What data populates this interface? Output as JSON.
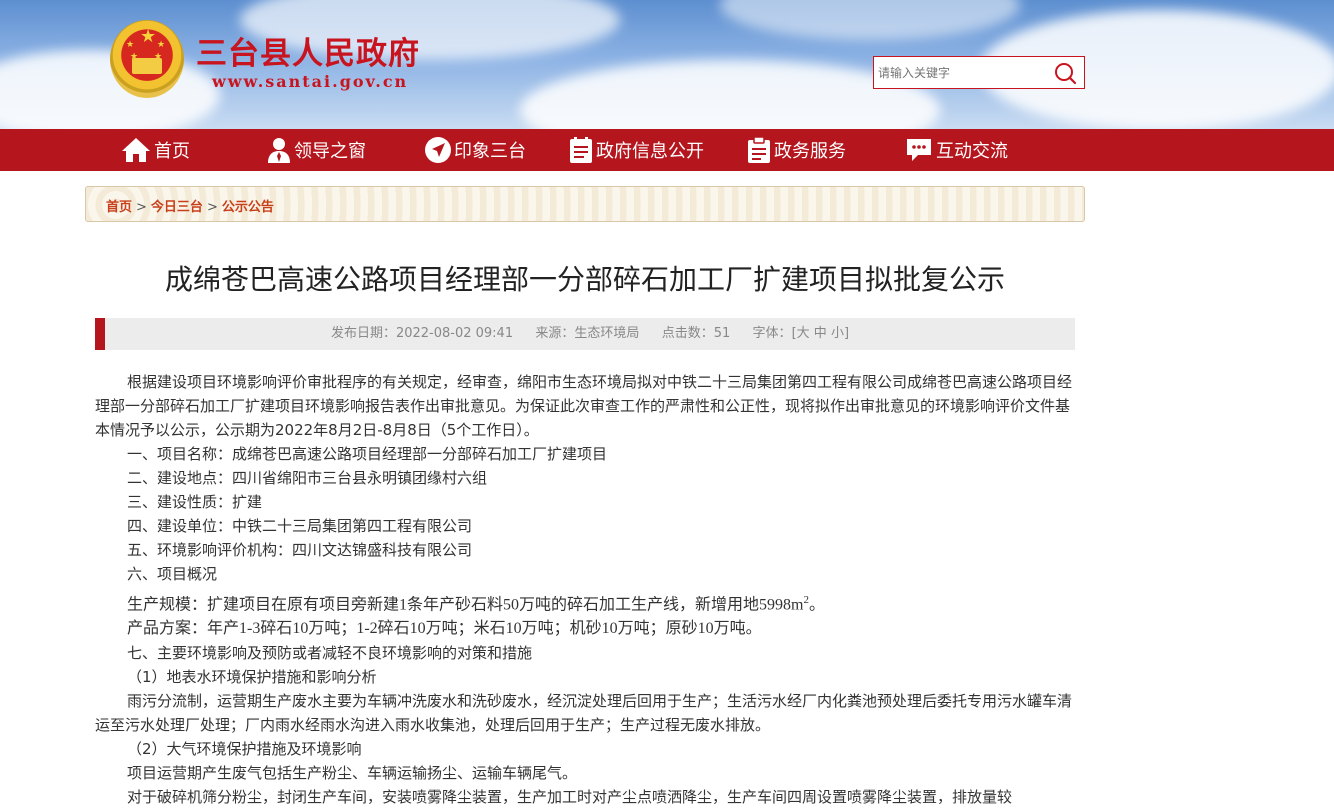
{
  "header": {
    "site_title": "三台县人民政府",
    "site_url": "www.santai.gov.cn",
    "search_placeholder": "请输入关键字",
    "brand_color": "#c8141e"
  },
  "nav": {
    "color": "#b5161d",
    "items": [
      {
        "label": "首页",
        "icon": "home-icon"
      },
      {
        "label": "领导之窗",
        "icon": "user-icon"
      },
      {
        "label": "印象三台",
        "icon": "send-icon"
      },
      {
        "label": "政府信息公开",
        "icon": "document-icon"
      },
      {
        "label": "政务服务",
        "icon": "clipboard-icon"
      },
      {
        "label": "互动交流",
        "icon": "chat-icon"
      }
    ]
  },
  "breadcrumb": {
    "items": [
      "首页",
      "今日三台",
      "公示公告"
    ],
    "separator": ">"
  },
  "article": {
    "title": "成绵苍巴高速公路项目经理部一分部碎石加工厂扩建项目拟批复公示",
    "meta": {
      "date_label": "发布日期：",
      "date": "2022-08-02 09:41",
      "source_label": "来源：",
      "source": "生态环境局",
      "hits_label": "点击数：",
      "hits": "51",
      "fontsize_label": "字体：",
      "fontsize_open": "[",
      "fs_large": "大",
      "fs_medium": "中",
      "fs_small": "小",
      "fontsize_close": "]"
    },
    "intro": "根据建设项目环境影响评价审批程序的有关规定，经审查，绵阳市生态环境局拟对中铁二十三局集团第四工程有限公司成绵苍巴高速公路项目经理部一分部碎石加工厂扩建项目环境影响报告表作出审批意见。为保证此次审查工作的严肃性和公正性，现将拟作出审批意见的环境影响评价文件基本情况予以公示，公示期为2022年8月2日-8月8日（5个工作日）。",
    "items": [
      "一、项目名称：成绵苍巴高速公路项目经理部一分部碎石加工厂扩建项目",
      "二、建设地点：四川省绵阳市三台县永明镇团缘村六组",
      "三、建设性质：扩建",
      "四、建设单位：中铁二十三局集团第四工程有限公司",
      "五、环境影响评价机构：四川文达锦盛科技有限公司",
      "六、项目概况"
    ],
    "scale_text": "生产规模：扩建项目在原有项目旁新建1条年产砂石料50万吨的碎石加工生产线，新增用地5998m",
    "scale_sup": "2",
    "scale_end": "。",
    "product_plan": "产品方案：年产1-3碎石10万吨；1-2碎石10万吨；米石10万吨；机砂10万吨；原砂10万吨。",
    "section7": "七、主要环境影响及预防或者减轻不良环境影响的对策和措施",
    "sub1": "（1）地表水环境保护措施和影响分析",
    "sub1_body": "雨污分流制，运营期生产废水主要为车辆冲洗废水和洗砂废水，经沉淀处理后回用于生产；生活污水经厂内化粪池预处理后委托专用污水罐车清运至污水处理厂处理；厂内雨水经雨水沟进入雨水收集池，处理后回用于生产；生产过程无废水排放。",
    "sub2": "（2）大气环境保护措施及环境影响",
    "sub2_body": "项目运营期产生废气包括生产粉尘、车辆运输扬尘、运输车辆尾气。",
    "sub2_more": "对于破碎机筛分粉尘，封闭生产车间，安装喷雾降尘装置，生产加工时对产尘点喷洒降尘，生产车间四周设置喷雾降尘装置，排放量较"
  }
}
